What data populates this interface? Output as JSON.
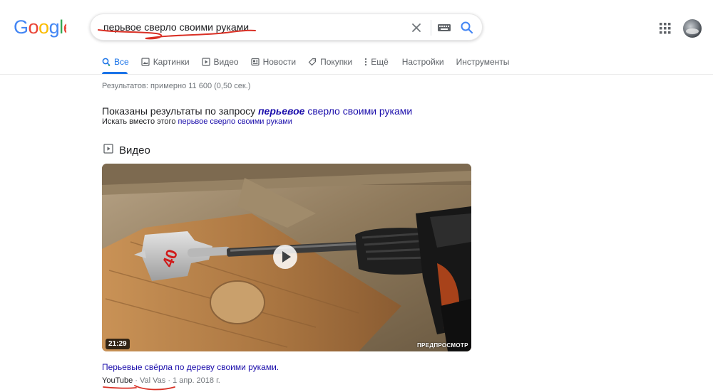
{
  "logo": {
    "text": "Google"
  },
  "search": {
    "query": "перьвое сверло своими руками",
    "clear_icon": "close-icon",
    "keyboard_icon": "keyboard-icon",
    "search_icon": "search-icon"
  },
  "header": {
    "apps_icon": "apps-grid-icon",
    "avatar_icon": "avatar"
  },
  "tabs": [
    {
      "label": "Все",
      "icon": "search-icon",
      "active": true
    },
    {
      "label": "Картинки",
      "icon": "image-icon"
    },
    {
      "label": "Видео",
      "icon": "video-icon"
    },
    {
      "label": "Новости",
      "icon": "news-icon"
    },
    {
      "label": "Покупки",
      "icon": "tag-icon"
    },
    {
      "label": "Ещё",
      "icon": "more-vert-icon"
    },
    {
      "label": "Настройки"
    },
    {
      "label": "Инструменты"
    }
  ],
  "results": {
    "stats": "Результатов: примерно 11 600 (0,50 сек.)"
  },
  "spelling": {
    "prefix": "Показаны результаты по запросу ",
    "corrected_bold": "перьевое",
    "corrected_rest": " сверло своими руками",
    "instead_prefix": "Искать вместо этого ",
    "instead_link": "перьвое сверло своими руками"
  },
  "video_section": {
    "heading": "Видео",
    "duration": "21:29",
    "preview_label": "ПРЕДПРОСМОТР",
    "title": "Перьевые свёрла по дереву своими руками.",
    "source": "YouTube",
    "sep1": " · ",
    "author": "Val Vas",
    "sep2": " · ",
    "date": "1 апр. 2018 г."
  },
  "colors": {
    "link": "#1a0dab",
    "accent": "#1a73e8",
    "annotation_red": "#d93025"
  }
}
